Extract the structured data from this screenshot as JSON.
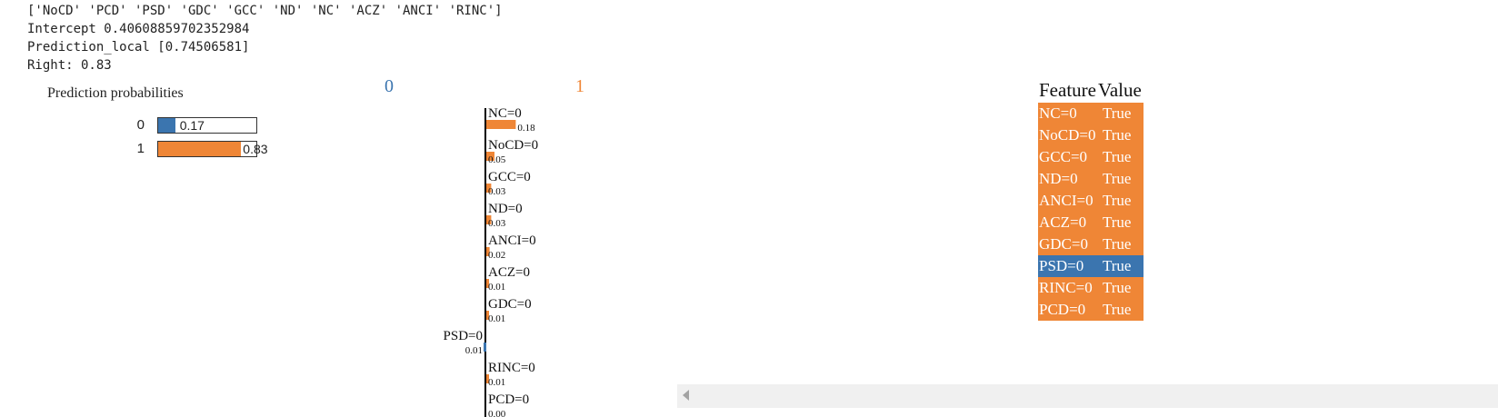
{
  "console": {
    "features_line": "['NoCD' 'PCD' 'PSD' 'GDC' 'GCC' 'ND' 'NC' 'ACZ' 'ANCI' 'RINC']",
    "intercept_line": "Intercept 0.40608859702352984",
    "prediction_line": "Prediction_local [0.74506581]",
    "right_line": "Right: 0.83"
  },
  "prediction_probabilities": {
    "title": "Prediction probabilities",
    "rows": [
      {
        "label": "0",
        "value": 0.17,
        "value_text": "0.17",
        "color": "#3b75af"
      },
      {
        "label": "1",
        "value": 0.83,
        "value_text": "0.83",
        "color": "#ef8636"
      }
    ]
  },
  "explanation": {
    "class_neg_label": "0",
    "class_pos_label": "1",
    "neg_color": "#3b75af",
    "pos_color": "#ef8636",
    "features": [
      {
        "name": "NC=0",
        "weight": 0.18,
        "weight_text": "0.18",
        "side": "pos"
      },
      {
        "name": "NoCD=0",
        "weight": 0.05,
        "weight_text": "0.05",
        "side": "pos"
      },
      {
        "name": "GCC=0",
        "weight": 0.03,
        "weight_text": "0.03",
        "side": "pos"
      },
      {
        "name": "ND=0",
        "weight": 0.03,
        "weight_text": "0.03",
        "side": "pos"
      },
      {
        "name": "ANCI=0",
        "weight": 0.02,
        "weight_text": "0.02",
        "side": "pos"
      },
      {
        "name": "ACZ=0",
        "weight": 0.01,
        "weight_text": "0.01",
        "side": "pos"
      },
      {
        "name": "GDC=0",
        "weight": 0.01,
        "weight_text": "0.01",
        "side": "pos"
      },
      {
        "name": "PSD=0",
        "weight": 0.01,
        "weight_text": "0.01",
        "side": "neg"
      },
      {
        "name": "RINC=0",
        "weight": 0.01,
        "weight_text": "0.01",
        "side": "pos"
      },
      {
        "name": "PCD=0",
        "weight": 0.0,
        "weight_text": "0.00",
        "side": "pos"
      }
    ]
  },
  "feature_table": {
    "headers": [
      "Feature",
      "Value"
    ],
    "rows": [
      {
        "feature": "NC=0",
        "value": "True",
        "color": "#ef8636"
      },
      {
        "feature": "NoCD=0",
        "value": "True",
        "color": "#ef8636"
      },
      {
        "feature": "GCC=0",
        "value": "True",
        "color": "#ef8636"
      },
      {
        "feature": "ND=0",
        "value": "True",
        "color": "#ef8636"
      },
      {
        "feature": "ANCI=0",
        "value": "True",
        "color": "#ef8636"
      },
      {
        "feature": "ACZ=0",
        "value": "True",
        "color": "#ef8636"
      },
      {
        "feature": "GDC=0",
        "value": "True",
        "color": "#ef8636"
      },
      {
        "feature": "PSD=0",
        "value": "True",
        "color": "#3b75af"
      },
      {
        "feature": "RINC=0",
        "value": "True",
        "color": "#ef8636"
      },
      {
        "feature": "PCD=0",
        "value": "True",
        "color": "#ef8636"
      }
    ]
  },
  "scrollbar": {
    "icon": "scroll-left-arrow-icon"
  }
}
